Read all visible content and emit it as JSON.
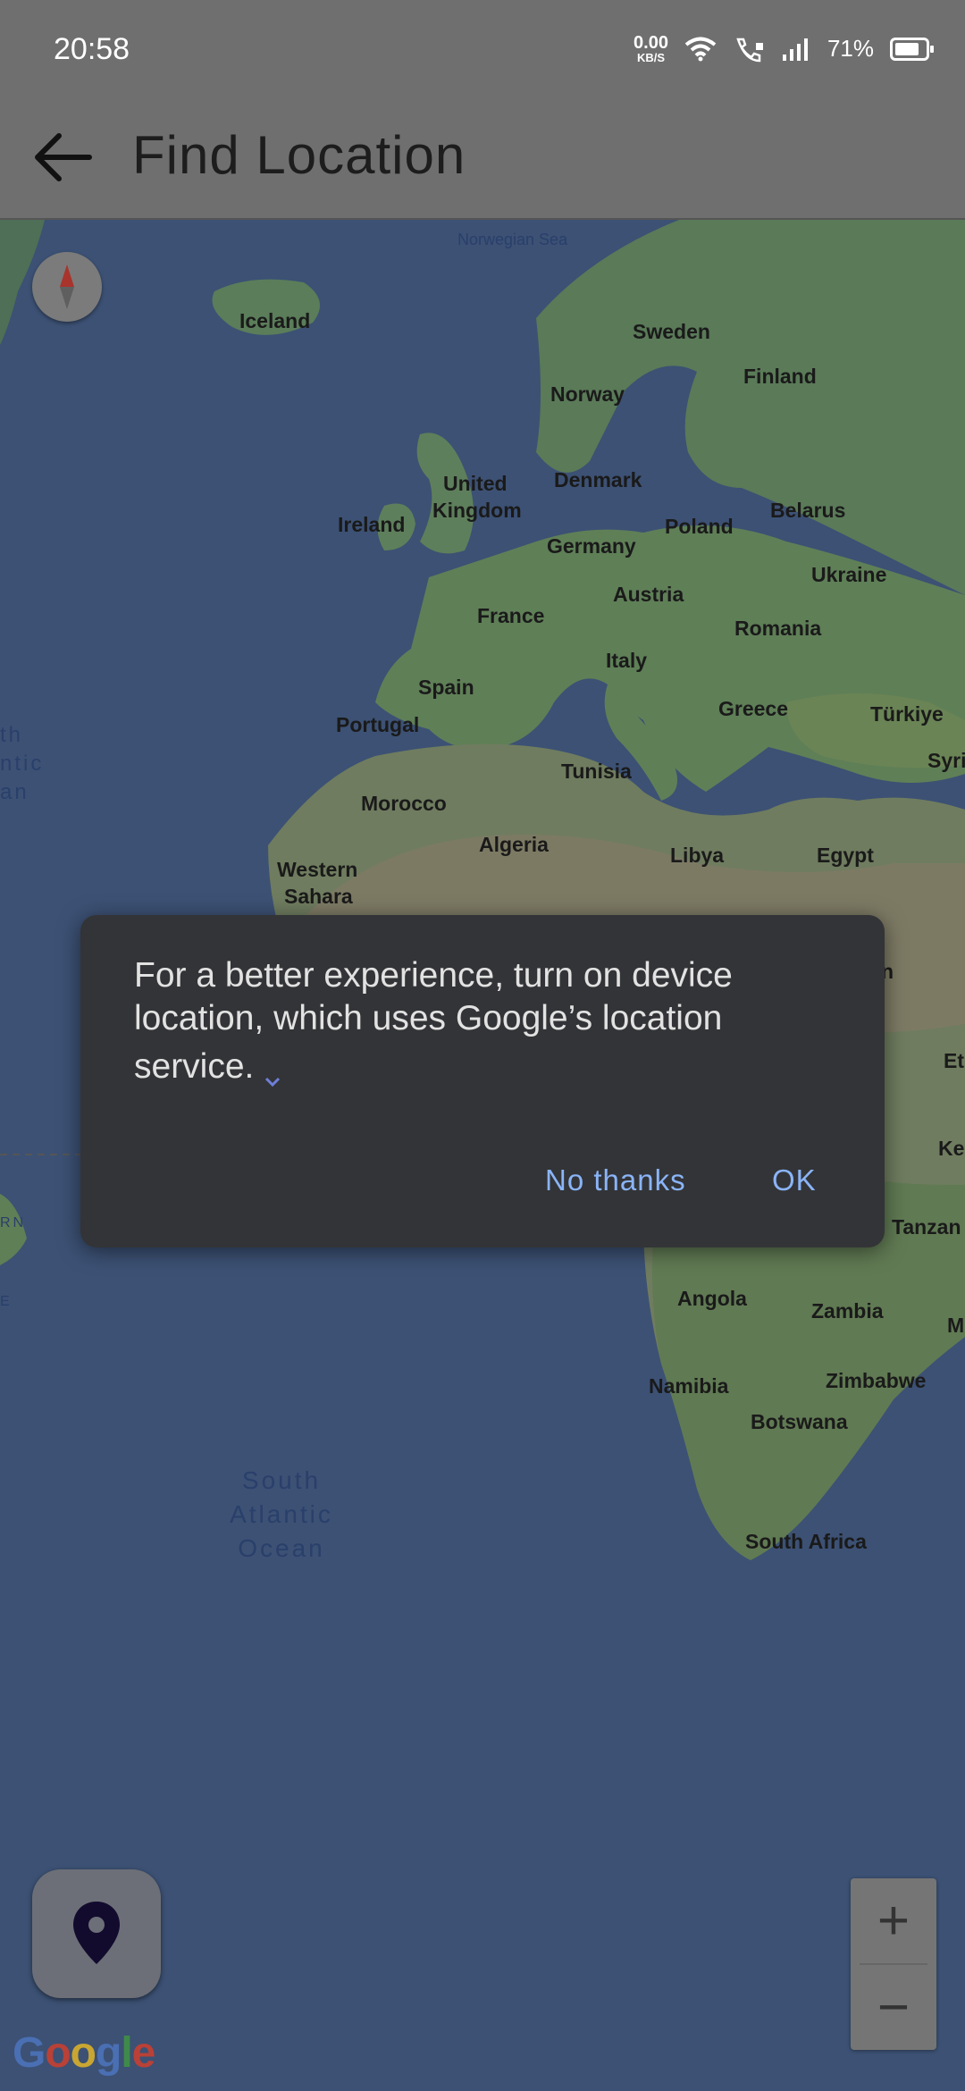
{
  "status_bar": {
    "time": "20:58",
    "net_speed_value": "0.00",
    "net_speed_unit": "KB/S",
    "battery": "71%",
    "icons": [
      "wifi-icon",
      "wifi-call-icon",
      "signal-icon",
      "battery-icon"
    ]
  },
  "app_bar": {
    "title": "Find Location",
    "back_icon": "arrow-left-icon"
  },
  "map": {
    "labels": {
      "norwegian_sea": "Norwegian Sea",
      "iceland": "Iceland",
      "sweden": "Sweden",
      "finland": "Finland",
      "norway": "Norway",
      "united_kingdom_1": "United",
      "united_kingdom_2": "Kingdom",
      "denmark": "Denmark",
      "ireland": "Ireland",
      "poland": "Poland",
      "belarus": "Belarus",
      "germany": "Germany",
      "ukraine": "Ukraine",
      "austria": "Austria",
      "france": "France",
      "romania": "Romania",
      "italy": "Italy",
      "spain": "Spain",
      "greece": "Greece",
      "turkiye": "Türkiye",
      "syria": "Syri",
      "portugal": "Portugal",
      "tunisia": "Tunisia",
      "morocco": "Morocco",
      "algeria": "Algeria",
      "libya": "Libya",
      "egypt": "Egypt",
      "western_sahara_1": "Western",
      "western_sahara_2": "Sahara",
      "n_atlantic_1": "th",
      "n_atlantic_2": "ntic",
      "n_atlantic_3": "an",
      "sudan_partial": "n",
      "ethiopia_partial": "Et",
      "kenya_partial": "Ke",
      "tanzania": "Tanzan",
      "angola": "Angola",
      "zambia": "Zambia",
      "malawi_partial": "M",
      "namibia": "Namibia",
      "zimbabwe": "Zimbabwe",
      "botswana": "Botswana",
      "south_africa": "South Africa",
      "s_atlantic_1": "South",
      "s_atlantic_2": "Atlantic",
      "s_atlantic_3": "Ocean",
      "rn_partial": "RN",
      "e_partial": "E"
    },
    "zoom_in": "+",
    "zoom_out": "−",
    "attribution": "Google",
    "brand_colors": [
      "#4a6fb3",
      "#b94137",
      "#c9a632",
      "#4a6fb3",
      "#3f8a4a",
      "#b94137"
    ]
  },
  "dialog": {
    "message_line1": "For a better experience, turn on device",
    "message_line2": "location, which uses Google’s location",
    "message_line3": "service.",
    "no_thanks": "No thanks",
    "ok": "OK"
  }
}
